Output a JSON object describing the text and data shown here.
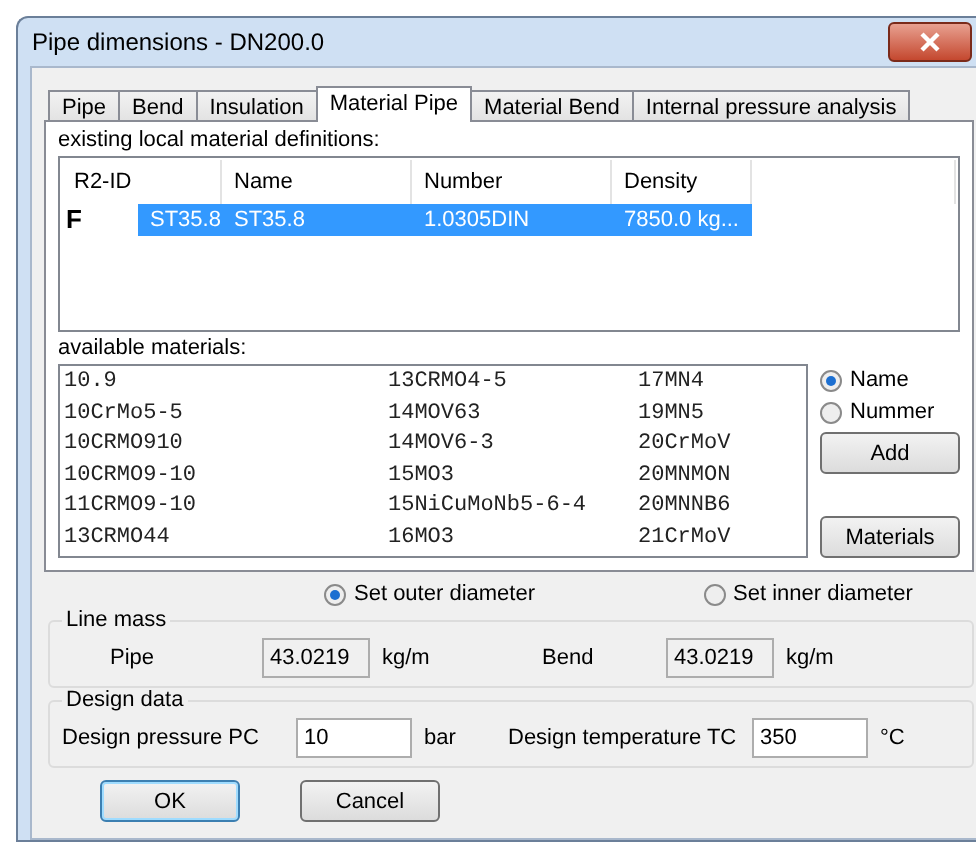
{
  "window": {
    "title": "Pipe dimensions - DN200.0"
  },
  "tabs": [
    {
      "label": "Pipe",
      "selected": false
    },
    {
      "label": "Bend",
      "selected": false
    },
    {
      "label": "Insulation",
      "selected": false
    },
    {
      "label": "Material Pipe",
      "selected": true
    },
    {
      "label": "Material Bend",
      "selected": false
    },
    {
      "label": "Internal pressure analysis",
      "selected": false
    }
  ],
  "local_materials": {
    "label": "existing local material definitions:",
    "columns": [
      "R2-ID",
      "Name",
      "Number",
      "Density"
    ],
    "rows": [
      {
        "marker": "F",
        "cells": [
          "ST35.8",
          "ST35.8",
          "1.0305DIN",
          "7850.0 kg..."
        ],
        "selected": true
      }
    ]
  },
  "available_materials": {
    "label": "available materials:",
    "columns": [
      [
        "10.9",
        "10CrMo5-5",
        "10CRMO910",
        "10CRMO9-10",
        "11CRMO9-10",
        "13CRMO44"
      ],
      [
        "13CRMO4-5",
        "14MOV63",
        "14MOV6-3",
        "15MO3",
        "15NiCuMoNb5-6-4",
        "16MO3"
      ],
      [
        "17MN4",
        "19MN5",
        "20CrMoV",
        "20MNMON",
        "20MNNB6",
        "21CrMoV"
      ]
    ]
  },
  "sort_options": [
    {
      "label": "Name",
      "selected": true
    },
    {
      "label": "Nummer",
      "selected": false
    }
  ],
  "side_buttons": [
    "Add",
    "Materials"
  ],
  "diameter_options": [
    {
      "label": "Set outer diameter",
      "selected": true
    },
    {
      "label": "Set inner diameter",
      "selected": false
    }
  ],
  "line_mass": {
    "title": "Line mass",
    "fields": [
      {
        "label": "Pipe",
        "value": "43.0219",
        "unit": "kg/m"
      },
      {
        "label": "Bend",
        "value": "43.0219",
        "unit": "kg/m"
      }
    ]
  },
  "design_data": {
    "title": "Design data",
    "fields": [
      {
        "label": "Design pressure PC",
        "value": "10",
        "unit": "bar"
      },
      {
        "label": "Design temperature TC",
        "value": "350",
        "unit": "°C"
      }
    ]
  },
  "buttons": [
    {
      "label": "OK",
      "default": true
    },
    {
      "label": "Cancel",
      "default": false
    }
  ]
}
